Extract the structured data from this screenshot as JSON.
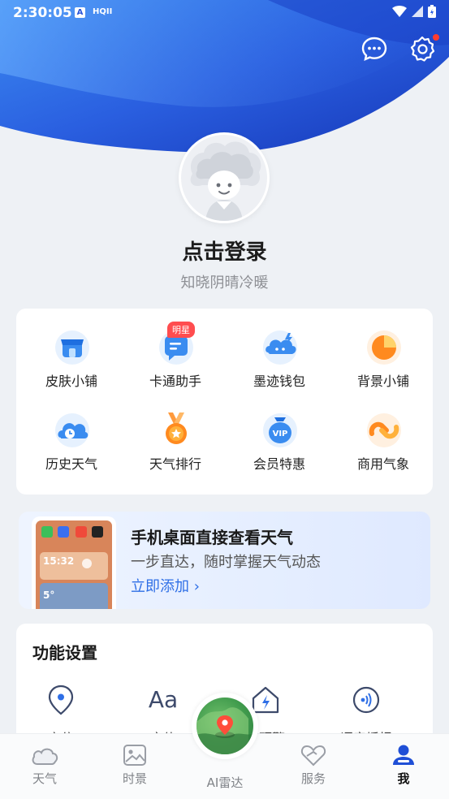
{
  "status_bar": {
    "time": "2:30:05",
    "badge_a": "A",
    "badge_hq": "HQII"
  },
  "header": {
    "login_title": "点击登录",
    "login_subtitle": "知晓阴晴冷暖"
  },
  "grid": {
    "items": [
      {
        "label": "皮肤小铺",
        "icon": "shop-icon"
      },
      {
        "label": "卡通助手",
        "icon": "cartoon-assistant-icon",
        "badge": "明星"
      },
      {
        "label": "墨迹钱包",
        "icon": "wallet-icon"
      },
      {
        "label": "背景小铺",
        "icon": "background-icon"
      },
      {
        "label": "历史天气",
        "icon": "history-weather-icon"
      },
      {
        "label": "天气排行",
        "icon": "ranking-medal-icon"
      },
      {
        "label": "会员特惠",
        "icon": "vip-icon"
      },
      {
        "label": "商用气象",
        "icon": "commercial-weather-icon"
      }
    ]
  },
  "promo": {
    "title": "手机桌面直接查看天气",
    "subtitle": "一步直达，随时掌握天气动态",
    "link": "立即添加 ›",
    "widget_time": "15:32",
    "widget_temp": "5°"
  },
  "functions": {
    "title": "功能设置",
    "items": [
      {
        "label": "定位",
        "icon": "location-icon"
      },
      {
        "label": "字体",
        "icon": "font-icon"
      },
      {
        "label": "暴预警",
        "icon": "warning-icon"
      },
      {
        "label": "语音播报",
        "icon": "voice-icon"
      }
    ]
  },
  "bottom_nav": {
    "items": [
      {
        "label": "天气",
        "icon": "weather-cloud-icon"
      },
      {
        "label": "时景",
        "icon": "image-icon"
      },
      {
        "label": "AI雷达",
        "icon": "radar-icon"
      },
      {
        "label": "服务",
        "icon": "service-heart-icon"
      },
      {
        "label": "我",
        "icon": "profile-icon",
        "active": true
      }
    ]
  },
  "colors": {
    "brand_blue": "#2f6fe6",
    "header_blue": "#1f4fd6",
    "badge_red": "#ff4d4f"
  }
}
